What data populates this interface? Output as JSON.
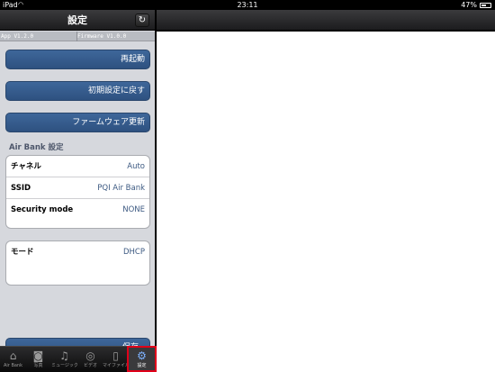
{
  "status_bar": {
    "carrier": "iPad",
    "time": "23:11",
    "battery": "47%"
  },
  "master": {
    "title": "設定",
    "refresh_icon": "refresh-icon",
    "app_version": "App V1.2.0",
    "firmware_version": "Firmware V1.0.0",
    "buttons": {
      "restart": "再起動",
      "reset": "初期設定に戻す",
      "firmware_update": "ファームウェア更新",
      "save": "保存"
    },
    "section_header": "Air Bank 設定",
    "settings": [
      {
        "key": "チャネル",
        "value": "Auto"
      },
      {
        "key": "SSID",
        "value": "PQI Air Bank"
      },
      {
        "key": "Security mode",
        "value": "NONE"
      }
    ],
    "mode": {
      "key": "モード",
      "value": "DHCP"
    }
  },
  "tab_bar": {
    "tabs": [
      {
        "label": "Air Bank",
        "icon": "drive-icon"
      },
      {
        "label": "写真",
        "icon": "camera-icon"
      },
      {
        "label": "ミュージック",
        "icon": "music-icon"
      },
      {
        "label": "ビデオ",
        "icon": "film-icon"
      },
      {
        "label": "マイファイル",
        "icon": "phone-icon"
      },
      {
        "label": "設定",
        "icon": "gears-icon",
        "selected": true
      }
    ]
  },
  "colors": {
    "accent_button": "#2e5180",
    "highlight": "#e0001a"
  }
}
